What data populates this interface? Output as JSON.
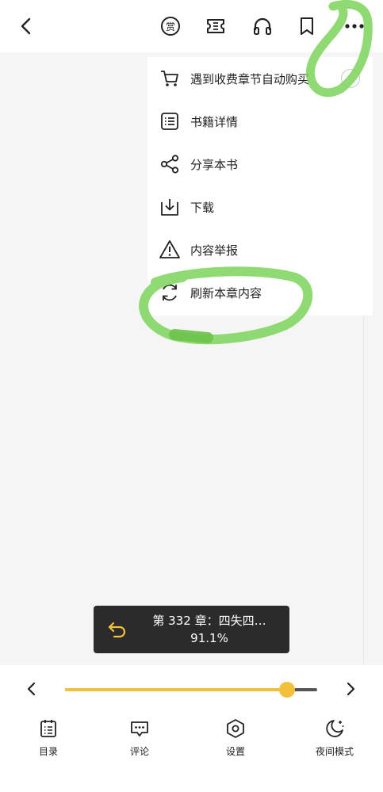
{
  "menu": {
    "items": [
      {
        "label": "遇到收费章节自动购买",
        "icon": "cart-icon",
        "toggle": false
      },
      {
        "label": "书籍详情",
        "icon": "list-icon"
      },
      {
        "label": "分享本书",
        "icon": "share-icon"
      },
      {
        "label": "下载",
        "icon": "download-icon"
      },
      {
        "label": "内容举报",
        "icon": "warning-icon"
      },
      {
        "label": "刷新本章内容",
        "icon": "refresh-icon"
      }
    ]
  },
  "toast": {
    "chapter": "第 332 章：四失四…",
    "progress": "91.1%"
  },
  "bottom": {
    "progress_fraction": 0.881,
    "tools": [
      "目录",
      "评论",
      "设置",
      "夜间模式"
    ]
  },
  "colors": {
    "accent": "#f2c03a",
    "annotation": "#7dd35a",
    "toast_bg": "#2b2b2b"
  }
}
